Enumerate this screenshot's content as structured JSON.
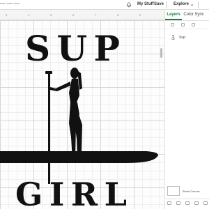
{
  "header": {
    "mystuff_label": "My Stuff",
    "save_label": "Save",
    "explore_label": "Explore",
    "explore_caret": "⌄"
  },
  "ruler": {
    "marks": [
      "3",
      "4",
      "5",
      "6",
      "7",
      "8",
      "9"
    ]
  },
  "canvas": {
    "top_text": "SUP",
    "bottom_text": "GIRL"
  },
  "panel": {
    "tabs": [
      "Layers",
      "Color Sync"
    ],
    "layers": [
      {
        "label": "Sup",
        "icon": "anchor-icon"
      }
    ],
    "blank_canvas_label": "Blank Canvas"
  },
  "colors": {
    "accent": "#1b7a44",
    "design": "#111111"
  }
}
